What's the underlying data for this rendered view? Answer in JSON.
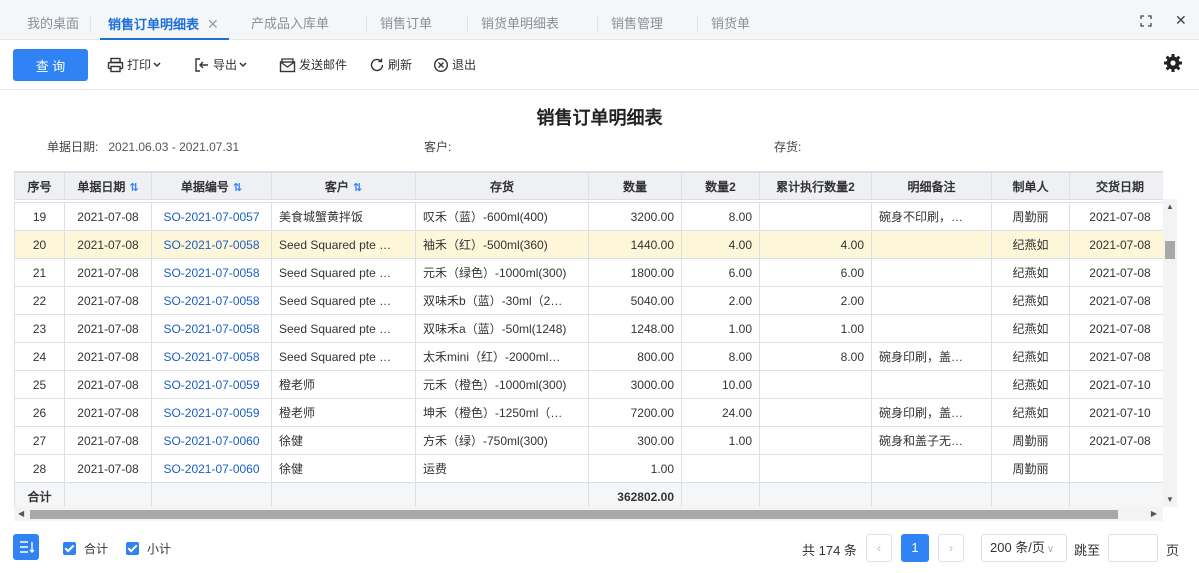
{
  "tabs": [
    {
      "label": "我的桌面"
    },
    {
      "label": "销售订单明细表",
      "active": true
    },
    {
      "label": "产成品入库单"
    },
    {
      "label": "销售订单"
    },
    {
      "label": "销货单明细表"
    },
    {
      "label": "销售管理"
    },
    {
      "label": "销货单"
    }
  ],
  "toolbar": {
    "query": "查 询",
    "print": "打印",
    "export": "导出",
    "email": "发送邮件",
    "refresh": "刷新",
    "exit": "退出"
  },
  "report": {
    "title": "销售订单明细表",
    "filters": {
      "date_label": "单据日期:",
      "date_value": "2021.06.03 - 2021.07.31",
      "customer_label": "客户:",
      "stock_label": "存货:"
    }
  },
  "table": {
    "columns": [
      "序号",
      "单据日期",
      "单据编号",
      "客户",
      "存货",
      "数量",
      "数量2",
      "累计执行数量2",
      "明细备注",
      "制单人",
      "交货日期"
    ],
    "rows": [
      [
        "19",
        "2021-07-08",
        "SO-2021-07-0057",
        "美食城蟹黄拌饭",
        "叹禾（蓝）-600ml(400)",
        "3200.00",
        "8.00",
        "",
        "碗身不印刷，…",
        "周勤丽",
        "2021-07-08"
      ],
      [
        "20",
        "2021-07-08",
        "SO-2021-07-0058",
        "Seed Squared pte …",
        "袖禾（红）-500ml(360)",
        "1440.00",
        "4.00",
        "4.00",
        "",
        "纪燕如",
        "2021-07-08"
      ],
      [
        "21",
        "2021-07-08",
        "SO-2021-07-0058",
        "Seed Squared pte …",
        "元禾（绿色）-1000ml(300)",
        "1800.00",
        "6.00",
        "6.00",
        "",
        "纪燕如",
        "2021-07-08"
      ],
      [
        "22",
        "2021-07-08",
        "SO-2021-07-0058",
        "Seed Squared pte …",
        "双味禾b（蓝）-30ml（2…",
        "5040.00",
        "2.00",
        "2.00",
        "",
        "纪燕如",
        "2021-07-08"
      ],
      [
        "23",
        "2021-07-08",
        "SO-2021-07-0058",
        "Seed Squared pte …",
        "双味禾a（蓝）-50ml(1248)",
        "1248.00",
        "1.00",
        "1.00",
        "",
        "纪燕如",
        "2021-07-08"
      ],
      [
        "24",
        "2021-07-08",
        "SO-2021-07-0058",
        "Seed Squared pte …",
        "太禾mini（红）-2000ml…",
        "800.00",
        "8.00",
        "8.00",
        "碗身印刷，盖…",
        "纪燕如",
        "2021-07-08"
      ],
      [
        "25",
        "2021-07-08",
        "SO-2021-07-0059",
        "橙老师",
        "元禾（橙色）-1000ml(300)",
        "3000.00",
        "10.00",
        "",
        "",
        "纪燕如",
        "2021-07-10"
      ],
      [
        "26",
        "2021-07-08",
        "SO-2021-07-0059",
        "橙老师",
        "坤禾（橙色）-1250ml（…",
        "7200.00",
        "24.00",
        "",
        "碗身印刷，盖…",
        "纪燕如",
        "2021-07-10"
      ],
      [
        "27",
        "2021-07-08",
        "SO-2021-07-0060",
        "徐健",
        "方禾（绿）-750ml(300)",
        "300.00",
        "1.00",
        "",
        "碗身和盖子无…",
        "周勤丽",
        "2021-07-08"
      ],
      [
        "28",
        "2021-07-08",
        "SO-2021-07-0060",
        "徐健",
        "运费",
        "1.00",
        "",
        "",
        "",
        "周勤丽",
        ""
      ]
    ],
    "selected_row": 1,
    "total_label": "合计",
    "total_quantity": "362802.00"
  },
  "footer": {
    "sum_label": "合计",
    "subtotal_label": "小计",
    "total_count": "共 174 条",
    "current_page": "1",
    "page_size": "200 条/页",
    "jump_label": "跳至",
    "page_unit": "页"
  },
  "colors": {
    "accent": "#2f83f4",
    "selected_row": "#fdf6d9",
    "link": "#1a5fc8"
  }
}
